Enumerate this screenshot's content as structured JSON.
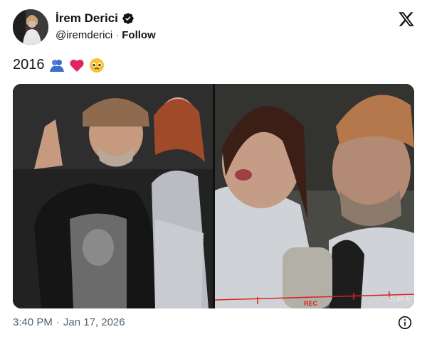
{
  "author": {
    "name": "İrem Derici",
    "handle": "@iremderici",
    "separator": "·",
    "follow_label": "Follow"
  },
  "tweet": {
    "text": "2016",
    "emojis": [
      "people-hugging-emoji",
      "red-heart-emoji",
      "face-holding-back-tears-emoji"
    ]
  },
  "media": {
    "right_overlay": {
      "rec": "REC",
      "clip": "CLIP A"
    }
  },
  "footer": {
    "time": "3:40 PM",
    "separator": "·",
    "date": "Jan 17, 2026"
  },
  "colors": {
    "text": "#0f1419",
    "secondary": "#536471",
    "verified": "#0f1419",
    "heart": "#e0245e",
    "people": "#3b6ecf",
    "tears_face": "#f7c22c"
  }
}
